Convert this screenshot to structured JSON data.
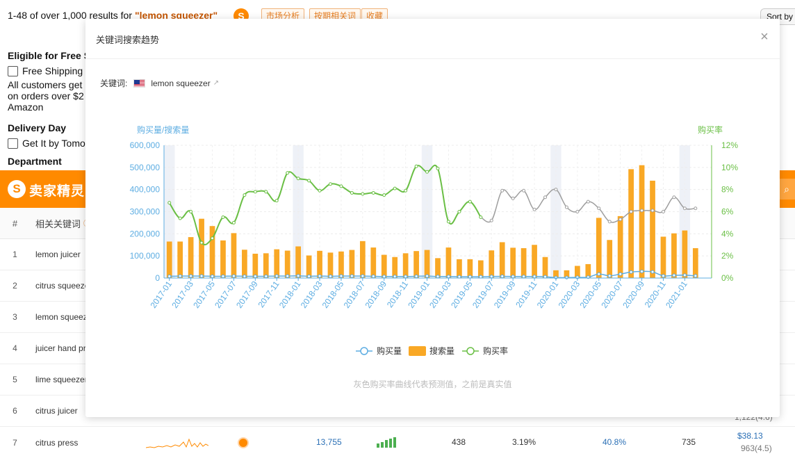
{
  "results": {
    "prefix": "1-48 of over 1,000 results for",
    "query": "\"lemon squeezer\"",
    "ext_logo": "S",
    "chips": [
      "市场分析",
      "按期相关词",
      "收藏"
    ],
    "sort_label": "Sort by"
  },
  "sidebar": {
    "shipping_title": "Eligible for Free S",
    "free_shipping": "Free Shipping",
    "shipping_note_1": "All customers get",
    "shipping_note_2": "on orders over $2",
    "shipping_note_3": "Amazon",
    "delivery_title": "Delivery Day",
    "delivery_option": "Get It by Tomo",
    "department_title": "Department"
  },
  "brand": {
    "logo": "S",
    "name": "卖家精灵",
    "search_icon": "search-icon"
  },
  "table": {
    "head_num": "#",
    "head_kw": "相关关键词",
    "rows": [
      {
        "n": "1",
        "kw": "lemon juicer"
      },
      {
        "n": "2",
        "kw": "citrus squeeze"
      },
      {
        "n": "3",
        "kw": "lemon squeez"
      },
      {
        "n": "4",
        "kw": "juicer hand pr"
      },
      {
        "n": "5",
        "kw": "lime squeezer"
      },
      {
        "n": "6",
        "kw": "citrus juicer",
        "extra": "1,122(4.6)"
      }
    ],
    "row7": {
      "n": "7",
      "kw": "citrus press",
      "searches": "13,755",
      "purchases": "438",
      "rate": "3.19%",
      "share": "40.8%",
      "count": "735",
      "price": "$38.13",
      "rating": "963(4.5)"
    }
  },
  "modal": {
    "title": "关键词搜索趋势",
    "close": "×",
    "kw_label": "关键词:",
    "kw_value": "lemon squeezer",
    "footnote": "灰色购买率曲线代表预测值，之前是真实值"
  },
  "chart_data": {
    "type": "bar",
    "left_axis_title": "购买量/搜索量",
    "right_axis_title": "购买率",
    "left_ticks": [
      "0",
      "100,000",
      "200,000",
      "300,000",
      "400,000",
      "500,000",
      "600,000"
    ],
    "right_ticks": [
      "0%",
      "2%",
      "4%",
      "6%",
      "8%",
      "10%",
      "12%"
    ],
    "ylim": [
      0,
      600000
    ],
    "y2lim": [
      0,
      12
    ],
    "x_tick_labels": [
      "2017-01",
      "2017-03",
      "2017-05",
      "2017-07",
      "2017-09",
      "2017-11",
      "2018-01",
      "2018-03",
      "2018-05",
      "2018-07",
      "2018-09",
      "2018-11",
      "2019-01",
      "2019-03",
      "2019-05",
      "2019-07",
      "2019-09",
      "2019-11",
      "2020-01",
      "2020-03",
      "2020-05",
      "2020-07",
      "2020-09",
      "2020-11",
      "2021-01"
    ],
    "months": [
      "2017-01",
      "2017-02",
      "2017-03",
      "2017-04",
      "2017-05",
      "2017-06",
      "2017-07",
      "2017-08",
      "2017-09",
      "2017-10",
      "2017-11",
      "2017-12",
      "2018-01",
      "2018-02",
      "2018-03",
      "2018-04",
      "2018-05",
      "2018-06",
      "2018-07",
      "2018-08",
      "2018-09",
      "2018-10",
      "2018-11",
      "2018-12",
      "2019-01",
      "2019-02",
      "2019-03",
      "2019-04",
      "2019-05",
      "2019-06",
      "2019-07",
      "2019-08",
      "2019-09",
      "2019-10",
      "2019-11",
      "2019-12",
      "2020-01",
      "2020-02",
      "2020-03",
      "2020-04",
      "2020-05",
      "2020-06",
      "2020-07",
      "2020-08",
      "2020-09",
      "2020-10",
      "2020-11",
      "2020-12",
      "2021-01",
      "2021-02",
      "2021-03"
    ],
    "highlight_months": [
      "2017-01",
      "2018-01",
      "2019-01",
      "2020-01",
      "2021-01"
    ],
    "series": [
      {
        "name": "搜索量",
        "type": "bar",
        "color": "#f9a825",
        "values": [
          165000,
          165000,
          185000,
          268000,
          235000,
          170000,
          203000,
          128000,
          110000,
          112000,
          130000,
          124000,
          143000,
          102000,
          123000,
          115000,
          120000,
          127000,
          167000,
          138000,
          105000,
          95000,
          112000,
          122000,
          127000,
          90000,
          138000,
          85000,
          85000,
          80000,
          125000,
          162000,
          137000,
          135000,
          150000,
          95000,
          35000,
          35000,
          55000,
          63000,
          272000,
          172000,
          280000,
          492000,
          510000,
          440000,
          187000,
          202000,
          215000,
          135000
        ]
      },
      {
        "name": "购买量",
        "type": "line",
        "color": "#5dade2",
        "values": [
          8000,
          9000,
          9000,
          9000,
          8000,
          8000,
          9000,
          8000,
          8000,
          8000,
          9000,
          9000,
          10000,
          8000,
          9000,
          8000,
          9000,
          9000,
          9000,
          8000,
          7000,
          7000,
          7000,
          8000,
          9000,
          7000,
          7000,
          6000,
          6000,
          6000,
          7000,
          8000,
          7000,
          7000,
          7000,
          6000,
          2000,
          2000,
          3000,
          4000,
          18000,
          10000,
          18000,
          27000,
          30000,
          28000,
          10000,
          12000,
          13000,
          10000
        ]
      },
      {
        "name": "购买率",
        "type": "line",
        "color": "#6abf45",
        "axis": "right",
        "forecast_color": "#9e9e9e",
        "actual_count": 30,
        "values": [
          6.8,
          5.4,
          6.0,
          3.2,
          3.6,
          5.5,
          5.0,
          7.5,
          7.8,
          7.8,
          7.0,
          9.5,
          9.0,
          8.8,
          7.9,
          8.5,
          8.3,
          7.7,
          7.6,
          7.7,
          7.5,
          8.1,
          7.9,
          10.1,
          9.6,
          9.9,
          5.1,
          6.0,
          6.9,
          5.5,
          5.2,
          7.9,
          7.2,
          7.9,
          6.2,
          7.3,
          8.0,
          6.4,
          6.0,
          6.9,
          6.3,
          5.1,
          5.3,
          6.0,
          6.1,
          6.1,
          6.0,
          7.3,
          6.3,
          6.3
        ]
      }
    ],
    "legend": [
      "购买量",
      "搜索量",
      "购买率"
    ],
    "legend_position": "bottom"
  }
}
